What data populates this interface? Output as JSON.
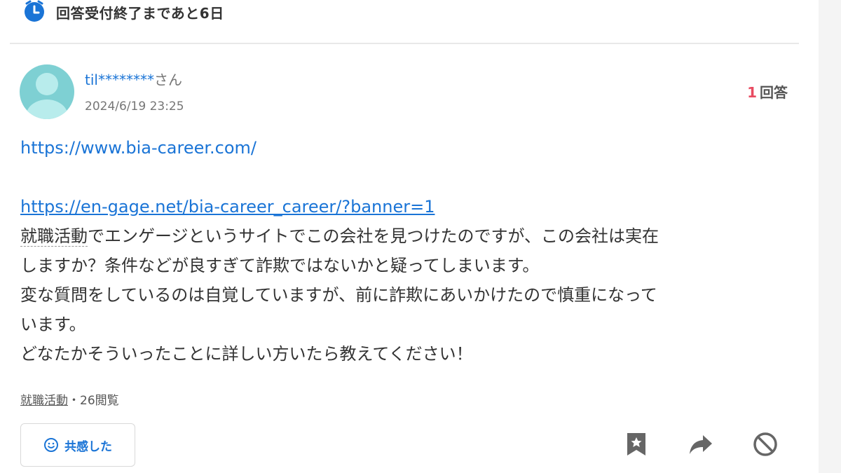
{
  "deadline": {
    "text": "回答受付終了まであと6日",
    "icon": "alarm-clock-icon"
  },
  "question": {
    "user_name": "til********",
    "user_suffix": "さん",
    "posted_at": "2024/6/19 23:25",
    "answer_count": "1",
    "answer_label": "回答",
    "links": [
      "https://www.bia-career.com/",
      "https://en-gage.net/bia-career_career/?banner=1"
    ],
    "lines": [
      "就職活動でエンゲージというサイトでこの会社を見つけたのですが、この会社は実在",
      "しますか？条件などが良すぎて詐欺ではないかと疑ってしまいます。",
      "変な質問をしているのは自覚していますが、前に詐欺にあいかけたので慎重になって",
      "います。",
      "どなたかそういったことに詳しい方いたら教えてください！"
    ],
    "category": "就職活動",
    "views": "・26閲覧",
    "empathy_label": "共感した"
  },
  "colors": {
    "link": "#1a74d6",
    "accent": "#e84b61",
    "text": "#333333",
    "subtext": "#767676"
  }
}
